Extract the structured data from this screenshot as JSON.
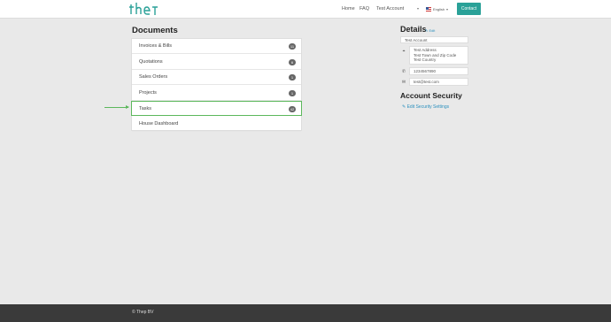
{
  "header": {
    "logo_text": "thep",
    "nav": {
      "home": "Home",
      "faq": "FAQ",
      "account": "Test Account"
    },
    "language": "English",
    "contact": "Contact"
  },
  "documents": {
    "title": "Documents",
    "items": [
      {
        "label": "Invoices & Bills",
        "count": "11"
      },
      {
        "label": "Quotations",
        "count": "6"
      },
      {
        "label": "Sales Orders",
        "count": "1"
      },
      {
        "label": "Projects",
        "count": "1"
      },
      {
        "label": "Tasks",
        "count": "42",
        "active": true
      },
      {
        "label": "House Dashboard",
        "count": ""
      }
    ]
  },
  "details": {
    "title": "Details",
    "edit": "Edit",
    "name": "Test Account",
    "address": [
      "Test Address",
      "Test Town and Zip Code",
      "Test Country"
    ],
    "phone": "1234567890",
    "email": "test@test.com"
  },
  "security": {
    "title": "Account Security",
    "link": "Edit Security Settings"
  },
  "footer": {
    "copyright": "© Thep BV"
  },
  "colors": {
    "accent": "#2aa198",
    "active_border": "#5cb85c",
    "link": "#2a8fbd"
  }
}
